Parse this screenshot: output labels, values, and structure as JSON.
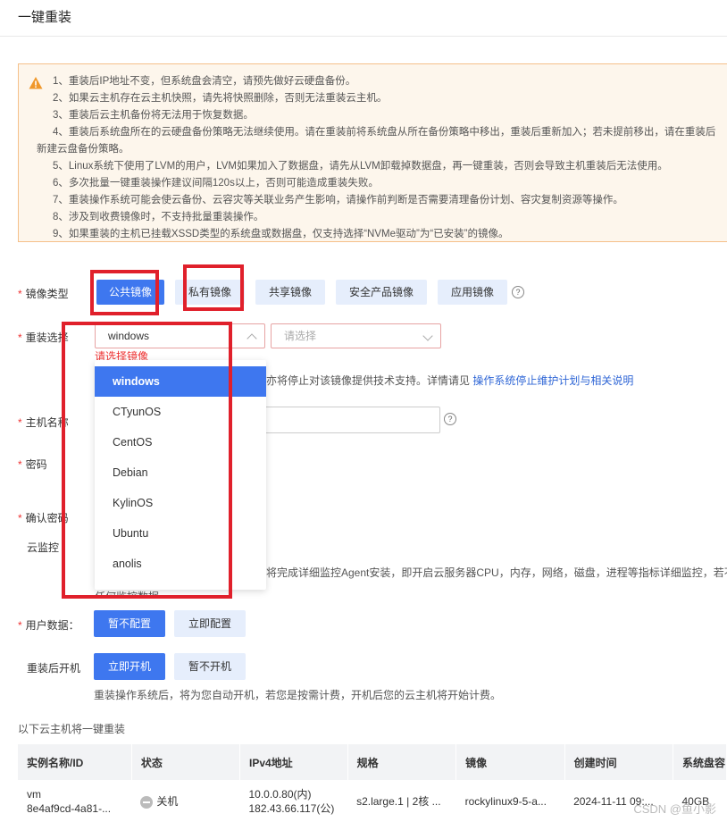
{
  "page": {
    "title": "一键重装"
  },
  "notice": {
    "lines": [
      "1、重装后IP地址不变，但系统盘会清空，请预先做好云硬盘备份。",
      "2、如果云主机存在云主机快照，请先将快照删除，否则无法重装云主机。",
      "3、重装后云主机备份将无法用于恢复数据。",
      "4、重装后系统盘所在的云硬盘备份策略无法继续使用。请在重装前将系统盘从所在备份策略中移出，重装后重新加入；若未提前移出，请在重装后",
      "新建云盘备份策略。",
      "5、Linux系统下使用了LVM的用户，LVM如果加入了数据盘，请先从LVM卸载掉数据盘，再一键重装，否则会导致主机重装后无法使用。",
      "6、多次批量一键重装操作建议间隔120s以上，否则可能造成重装失败。",
      "7、重装操作系统可能会使云备份、云容灾等关联业务产生影响，请操作前判断是否需要清理备份计划、容灾复制资源等操作。",
      "8、涉及到收费镜像时，不支持批量重装操作。",
      "9、如果重装的主机已挂载XSSD类型的系统盘或数据盘，仅支持选择“NVMe驱动”为“已安装”的镜像。"
    ]
  },
  "form": {
    "image_type": {
      "label": "镜像类型",
      "options": [
        "公共镜像",
        "私有镜像",
        "共享镜像",
        "安全产品镜像",
        "应用镜像"
      ],
      "selected": "公共镜像"
    },
    "reinstall_select": {
      "label": "重装选择",
      "value": "windows",
      "placeholder": "请选择",
      "error": "请选择镜像",
      "dropdown_options": [
        "windows",
        "CTyunOS",
        "CentOS",
        "Debian",
        "KylinOS",
        "Ubuntu",
        "anolis"
      ],
      "hint_text": "亦将停止对该镜像提供技术支持。详情请见",
      "hint_link": "操作系统停止维护计划与相关说明"
    },
    "hostname": {
      "label": "主机名称"
    },
    "password": {
      "label": "密码"
    },
    "confirm_password": {
      "label": "确认密码"
    },
    "cloud_monitor": {
      "label": "云监控",
      "desc": "将完成详细监控Agent安装，即开启云服务器CPU，内存，网络，磁盘，进程等指标详细监控，若不",
      "desc2": "任何监控数据"
    },
    "user_data": {
      "label": "用户数据：",
      "options": [
        "暂不配置",
        "立即配置"
      ],
      "selected": "暂不配置"
    },
    "power_on": {
      "label": "重装后开机",
      "options": [
        "立即开机",
        "暂不开机"
      ],
      "selected": "立即开机",
      "desc": "重装操作系统后，将为您自动开机，若您是按需计费，开机后您的云主机将开始计费。"
    }
  },
  "table": {
    "caption": "以下云主机将一键重装",
    "headers": [
      "实例名称/ID",
      "状态",
      "IPv4地址",
      "规格",
      "镜像",
      "创建时间",
      "系统盘容"
    ],
    "rows": [
      {
        "name": "vm",
        "id": "8e4af9cd-4a81-...",
        "status": "关机",
        "ip_inner": "10.0.0.80(内)",
        "ip_public": "182.43.66.117(公)",
        "spec": "s2.large.1 | 2核 ...",
        "image": "rockylinux9-5-a...",
        "created": "2024-11-11 09:...",
        "disk": "40GB"
      }
    ]
  },
  "watermark": "CSDN @鱼小影",
  "colors": {
    "primary": "#3e77ef",
    "light_button": "#e6eefc",
    "notice_bg": "#fdf6ec",
    "annotation_red": "#e0202b"
  }
}
